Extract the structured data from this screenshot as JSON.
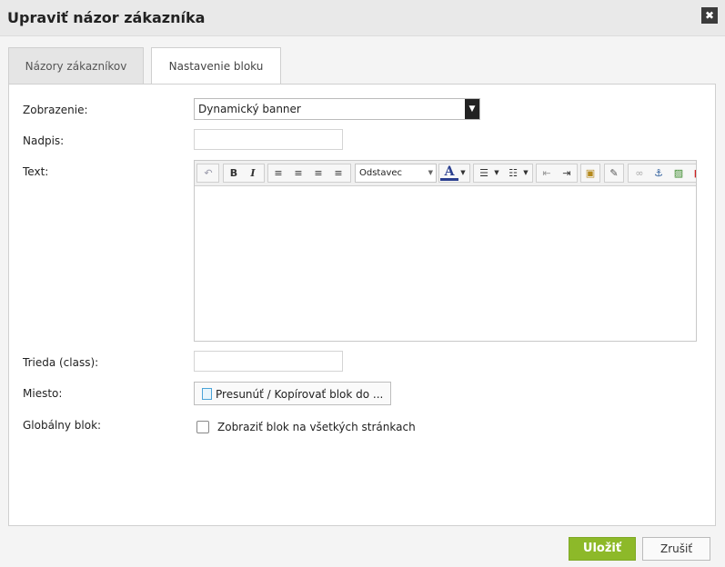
{
  "dialog": {
    "title": "Upraviť názor zákazníka",
    "close_label": "✖"
  },
  "tabs": [
    {
      "label": "Názory zákazníkov",
      "active": false
    },
    {
      "label": "Nastavenie bloku",
      "active": true
    }
  ],
  "form": {
    "display": {
      "label": "Zobrazenie:",
      "value": "Dynamický banner"
    },
    "heading": {
      "label": "Nadpis:",
      "value": ""
    },
    "text": {
      "label": "Text:",
      "format_value": "Odstavec"
    },
    "css_class": {
      "label": "Trieda (class):",
      "value": ""
    },
    "location": {
      "label": "Miesto:",
      "button_label": "Presunúť / Kopírovať blok do ..."
    },
    "global_block": {
      "label": "Globálny blok:",
      "checkbox_label": "Zobraziť blok na všetkých stránkach",
      "checked": false
    }
  },
  "toolbar": {
    "bold": "B",
    "italic": "I",
    "font_color": "A"
  },
  "footer": {
    "save_label": "Uložiť",
    "cancel_label": "Zrušiť"
  },
  "colors": {
    "accent_green": "#8db929",
    "title_bar": "#e9e9e9"
  }
}
